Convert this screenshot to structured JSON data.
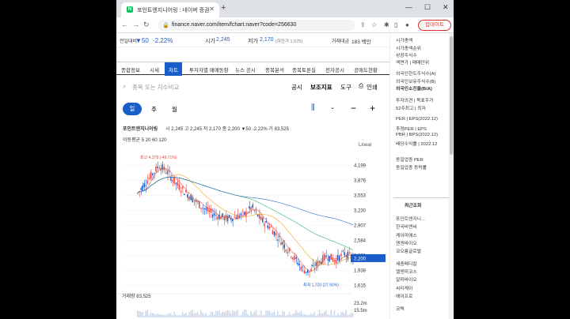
{
  "browser": {
    "tab_title": "포인트엔지니어링 : 네이버 증권",
    "url": "finance.naver.com/item/fchart.naver?code=256630",
    "update_label": "업데이트"
  },
  "quote": {
    "prev_label": "전일대비",
    "prev_change": "▼50",
    "prev_pct": "-2.22%",
    "open_label": "시가",
    "open": "2,245",
    "low_label": "저가",
    "low": "2,170",
    "low_limit": "(하한가 1,575)",
    "vol_amt_label": "거래대금",
    "vol_amt": "183 백만"
  },
  "nav": {
    "items": [
      "종합정보",
      "시세",
      "차트",
      "투자자별 매매동향",
      "뉴스 공시",
      "종목분석",
      "종목토론실",
      "전자공시",
      "공매도현황"
    ],
    "active": "차트"
  },
  "search": {
    "placeholder": "종목 또는 지수비교",
    "btn1": "공시",
    "btn2": "보조지표",
    "btn3": "도구",
    "btn4": "인쇄"
  },
  "period": {
    "items": [
      "일",
      "주",
      "월"
    ],
    "active": "일"
  },
  "info": {
    "name": "포인트엔지니어링",
    "line": "시 2,245  고 2,245  저 2,170  종 2,200  ▼50 -2.22%  거 83,525",
    "ma": "이동평균 5 20 60 120",
    "scale": "Linear"
  },
  "chart_data": {
    "type": "candlestick",
    "ylim": [
      1500,
      4500
    ],
    "ticks": [
      "4,199",
      "3,876",
      "3,553",
      "3,230",
      "2,907",
      "2,584",
      "2,261",
      "1,938",
      "1,615"
    ],
    "tick_values": [
      4199,
      3876,
      3553,
      3230,
      2907,
      2584,
      2261,
      1938,
      1615
    ],
    "current": "2,200",
    "current_value": 2200,
    "max_label": "최고 4,378 (-49.71%)",
    "min_label": "최저 1,720 (27.91%)",
    "volume_label": "거래량 83,525",
    "volume_ticks": [
      "23.2m",
      "15.5m"
    ]
  },
  "sidebar": {
    "rows": [
      "시가총액",
      "시가총액순위",
      "상장주식수",
      "액면가 | 매매단위",
      "외국인한도주식수(A)",
      "외국인보유주식수(B)",
      "외국인소진율(B/A)",
      "투자의견 | 목표주가",
      "52주최고 | 최저",
      "PER | EPS(2022.12)",
      "추정PER | EPS",
      "PBR | BPS(2022.12)",
      "배당수익률 | 2022.12",
      "동일업종 PER",
      "동일업종 등락률",
      "최근조회",
      "포인트엔지니...",
      "한국비엔씨",
      "케이피에스",
      "엔젠바이오",
      "코오롱글로벌",
      "세종메디칼",
      "엘앤피코스",
      "알피바이오",
      "씨티케이",
      "에이프로",
      "코텍"
    ]
  },
  "colors": {
    "accent": "#1a5cc8",
    "up": "#e8463c",
    "down": "#1a5cc8"
  }
}
